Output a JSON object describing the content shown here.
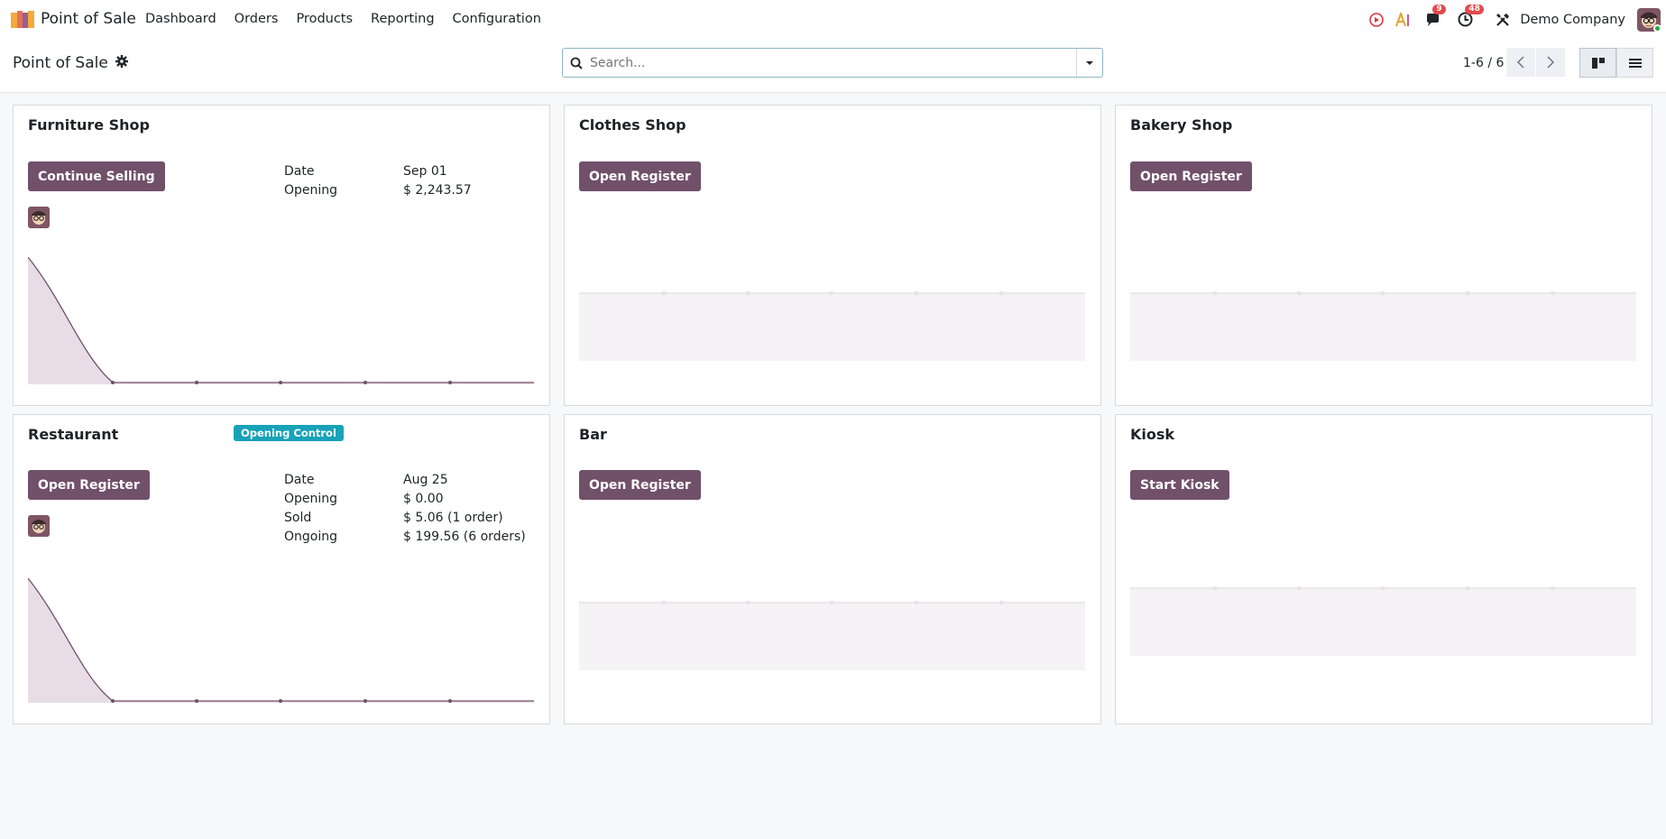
{
  "navbar": {
    "app_name": "Point of Sale",
    "menu": [
      "Dashboard",
      "Orders",
      "Products",
      "Reporting",
      "Configuration"
    ],
    "messages_count": "9",
    "activities_count": "48",
    "company": "Demo Company"
  },
  "control_panel": {
    "breadcrumb": "Point of Sale",
    "search_placeholder": "Search...",
    "pager": "1-6 / 6"
  },
  "cards": {
    "furniture": {
      "title": "Furniture Shop",
      "button": "Continue Selling",
      "info": [
        {
          "label": "Date",
          "value": "Sep 01"
        },
        {
          "label": "Opening",
          "value": "$ 2,243.57"
        }
      ]
    },
    "clothes": {
      "title": "Clothes Shop",
      "button": "Open Register"
    },
    "bakery": {
      "title": "Bakery Shop",
      "button": "Open Register"
    },
    "restaurant": {
      "title": "Restaurant",
      "status": "Opening Control",
      "button": "Open Register",
      "info": [
        {
          "label": "Date",
          "value": "Aug 25"
        },
        {
          "label": "Opening",
          "value": "$ 0.00"
        },
        {
          "label": "Sold",
          "value": "$ 5.06 (1 order)"
        },
        {
          "label": "Ongoing",
          "value": "$ 199.56 (6 orders)"
        }
      ]
    },
    "bar": {
      "title": "Bar",
      "button": "Open Register"
    },
    "kiosk": {
      "title": "Kiosk",
      "button": "Start Kiosk"
    }
  },
  "colors": {
    "primary": "#71506a",
    "status_info": "#17a2b8",
    "badge": "#e34a4a"
  }
}
